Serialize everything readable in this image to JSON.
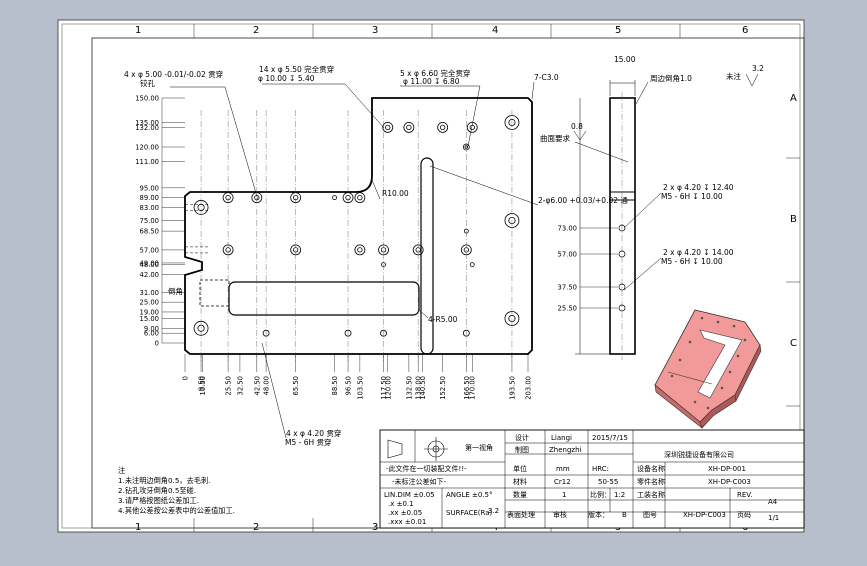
{
  "frame": {
    "columns": [
      "1",
      "2",
      "3",
      "4",
      "5",
      "6"
    ],
    "rows": [
      "A",
      "B",
      "C",
      "D"
    ]
  },
  "notes": {
    "title": "注",
    "lines": [
      "1.未注明边倒角0.5，去毛刺.",
      "2.钻孔攻牙倒角0.5至碰.",
      "3.请严格按图纸公差加工.",
      "4.其他公差按公差表中的公差值加工."
    ]
  },
  "title_block": {
    "projection": "第一视角",
    "no_change": "-此文件在一切装配文件!!-",
    "tolerance_title": "-未标注公差如下-",
    "tol_linear": "LIN.DIM ±0.05",
    "tol_r1": ".x ±0.1",
    "tol_r2": ".xx ±0.05",
    "tol_r3": ".xxx ±0.01",
    "tol_angle": "ANGLE ±0.5°",
    "roughness": "SURFACE(Ra)",
    "roughness_val": "3.2",
    "design_label": "设计",
    "design_name": "Liangi",
    "date": "2015/7/15",
    "draw_label": "制图",
    "draw_name": "Zhengzhi",
    "unit_label": "单位",
    "unit_value": "mm",
    "hrc_label": "HRC:",
    "material_label": "材料",
    "material_value": "Cr12",
    "hardness": "50-55",
    "qty_label": "数量",
    "qty_value": "1",
    "scale_label": "比例：",
    "scale_value": "1:2",
    "surface_label": "表面处理",
    "review_label": "审核",
    "version_label": "版本：",
    "version_value": "B",
    "sheet_no_label": "图号",
    "company": "深圳锐捷设备有限公司",
    "device_label": "设备名称",
    "device_value": "XH-DP-001",
    "part_label": "零件名称",
    "part_value": "XH-DP-C003",
    "process_label": "工装名称",
    "drawing_no": "XH-DP-C003",
    "rev_label": "REV.",
    "rev_value": "A4",
    "page_label": "页码",
    "page_value": "1/1"
  },
  "callouts": {
    "c1": "4 x φ 5.00 -0.01/-0.02 贯穿",
    "c1b": "铰孔",
    "c2": "14 x φ 5.50 完全贯穿",
    "c2b": "φ 10.00 ↧ 5.40",
    "c3": "5 x φ 6.60 完全贯穿",
    "c3b": "φ 11.00 ↧ 6.80",
    "c4": "7-C3.0",
    "c5": "R10.00",
    "c6": "2-φ6.00 +0.03/+0.02 通",
    "c7": "曲面要求",
    "c8": "4-R5.00",
    "c9": "4 x φ 4.20 贯穿",
    "c9b": "M5 - 6H 贯穿",
    "c10": "周边倒角1.0",
    "c11": "2 x φ 4.20 ↧ 12.40",
    "c11b": "M5 - 6H ↧ 10.00",
    "c12": "2 x φ 4.20 ↧ 14.00",
    "c12b": "M5 - 6H ↧ 10.00",
    "c13": "未注",
    "c14": "15.00",
    "c15": "0.8",
    "c16": "3.2",
    "c17": "倒角"
  },
  "dims_left": [
    "150.00",
    "135.00",
    "132.00",
    "120.00",
    "111.00",
    "95.00",
    "89.00",
    "83.00",
    "75.00",
    "68.50",
    "57.00",
    "49.00",
    "48.00",
    "42.00",
    "31.00",
    "25.00",
    "19.00",
    "15.00",
    "9.00",
    "6.00",
    "0"
  ],
  "dims_bottom": [
    "0",
    "9.50",
    "10.50",
    "25.50",
    "32.50",
    "42.50",
    "48.00",
    "65.50",
    "88.50",
    "96.50",
    "103.50",
    "117.50",
    "120.00",
    "132.50",
    "138.00",
    "140.50",
    "152.50",
    "166.50",
    "170.00",
    "193.50",
    "203.00"
  ],
  "dims_side": [
    "73.00",
    "57.00",
    "37.50",
    "25.50"
  ]
}
